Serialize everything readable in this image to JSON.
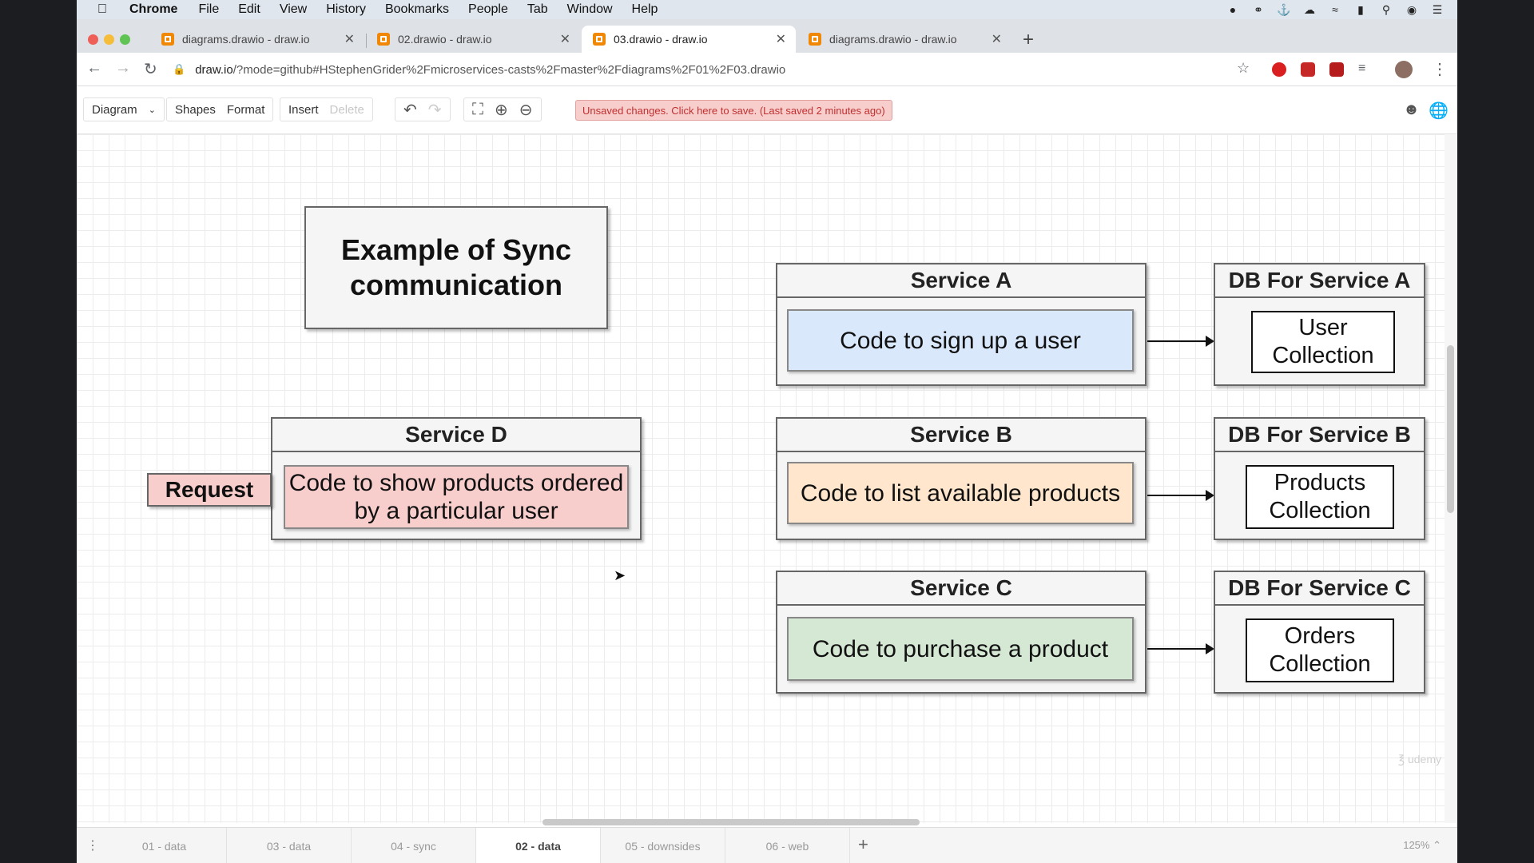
{
  "menubar": {
    "app_name": "Chrome",
    "items": [
      "File",
      "Edit",
      "View",
      "History",
      "Bookmarks",
      "People",
      "Tab",
      "Window",
      "Help"
    ]
  },
  "browser": {
    "tabs": [
      {
        "title": "diagrams.drawio - draw.io",
        "active": false
      },
      {
        "title": "02.drawio - draw.io",
        "active": false
      },
      {
        "title": "03.drawio - draw.io",
        "active": true
      },
      {
        "title": "diagrams.drawio - draw.io",
        "active": false
      }
    ],
    "url_host": "draw.io",
    "url_rest": "/?mode=github#HStephenGrider%2Fmicroservices-casts%2Fmaster%2Fdiagrams%2F01%2F03.drawio"
  },
  "toolbar": {
    "diagram_label": "Diagram",
    "shapes_label": "Shapes",
    "format_label": "Format",
    "insert_label": "Insert",
    "delete_label": "Delete",
    "unsaved_message": "Unsaved changes. Click here to save. (Last saved 2 minutes ago)"
  },
  "diagram": {
    "title": "Example of Sync communication",
    "request_label": "Request",
    "service_d": {
      "name": "Service D",
      "code": "Code to show products ordered by a particular user",
      "color": "#f8cecc"
    },
    "services": [
      {
        "name": "Service A",
        "code": "Code to sign up a user",
        "color": "#dae8fc",
        "db": "DB For Service A",
        "collection": "User Collection"
      },
      {
        "name": "Service B",
        "code": "Code to list available products",
        "color": "#ffe6cc",
        "db": "DB For Service B",
        "collection": "Products Collection"
      },
      {
        "name": "Service C",
        "code": "Code to purchase a product",
        "color": "#d5e8d4",
        "db": "DB For Service C",
        "collection": "Orders Collection"
      }
    ]
  },
  "pages": {
    "tabs": [
      "01 - data",
      "03 - data",
      "04 - sync",
      "02 - data",
      "05 - downsides",
      "06 - web"
    ],
    "active": "02 - data",
    "zoom": "125%"
  },
  "colors": {
    "unsaved_bg": "#f8cecc",
    "unsaved_text": "#c03030",
    "drawio_orange": "#f08705"
  }
}
